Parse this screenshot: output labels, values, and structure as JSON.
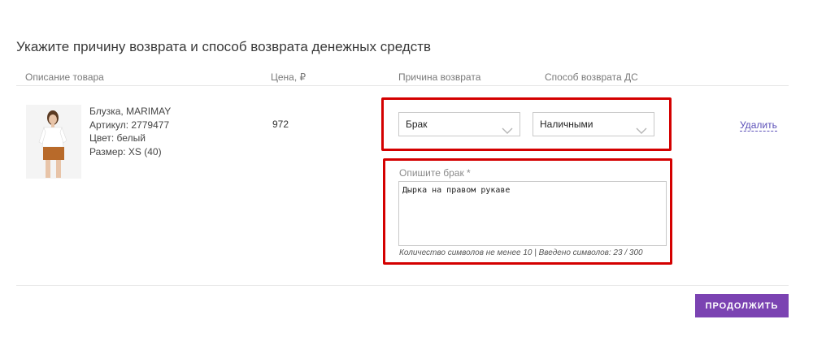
{
  "page": {
    "title": "Укажите причину возврата и способ возврата денежных средств"
  },
  "table": {
    "headers": {
      "description": "Описание товара",
      "price": "Цена, ₽",
      "reason": "Причина возврата",
      "method": "Способ возврата ДС"
    }
  },
  "product": {
    "name": "Блузка, MARIMAY",
    "article": "Артикул: 2779477",
    "color": "Цвет: белый",
    "size": "Размер: XS (40)",
    "price": "972"
  },
  "return": {
    "reason_selected": "Брак",
    "method_selected": "Наличными",
    "delete_label": "Удалить",
    "defect_label": "Опишите брак *",
    "defect_text": "Дырка на правом рукаве",
    "counter": "Количество символов не менее 10 | Введено символов: 23 / 300"
  },
  "actions": {
    "continue_label": "ПРОДОЛЖИТЬ"
  },
  "colors": {
    "accent": "#7b43b2",
    "highlight": "#d40000",
    "link": "#5b4fb8"
  },
  "icons": {
    "select_arrow": "chevron-down-icon"
  }
}
